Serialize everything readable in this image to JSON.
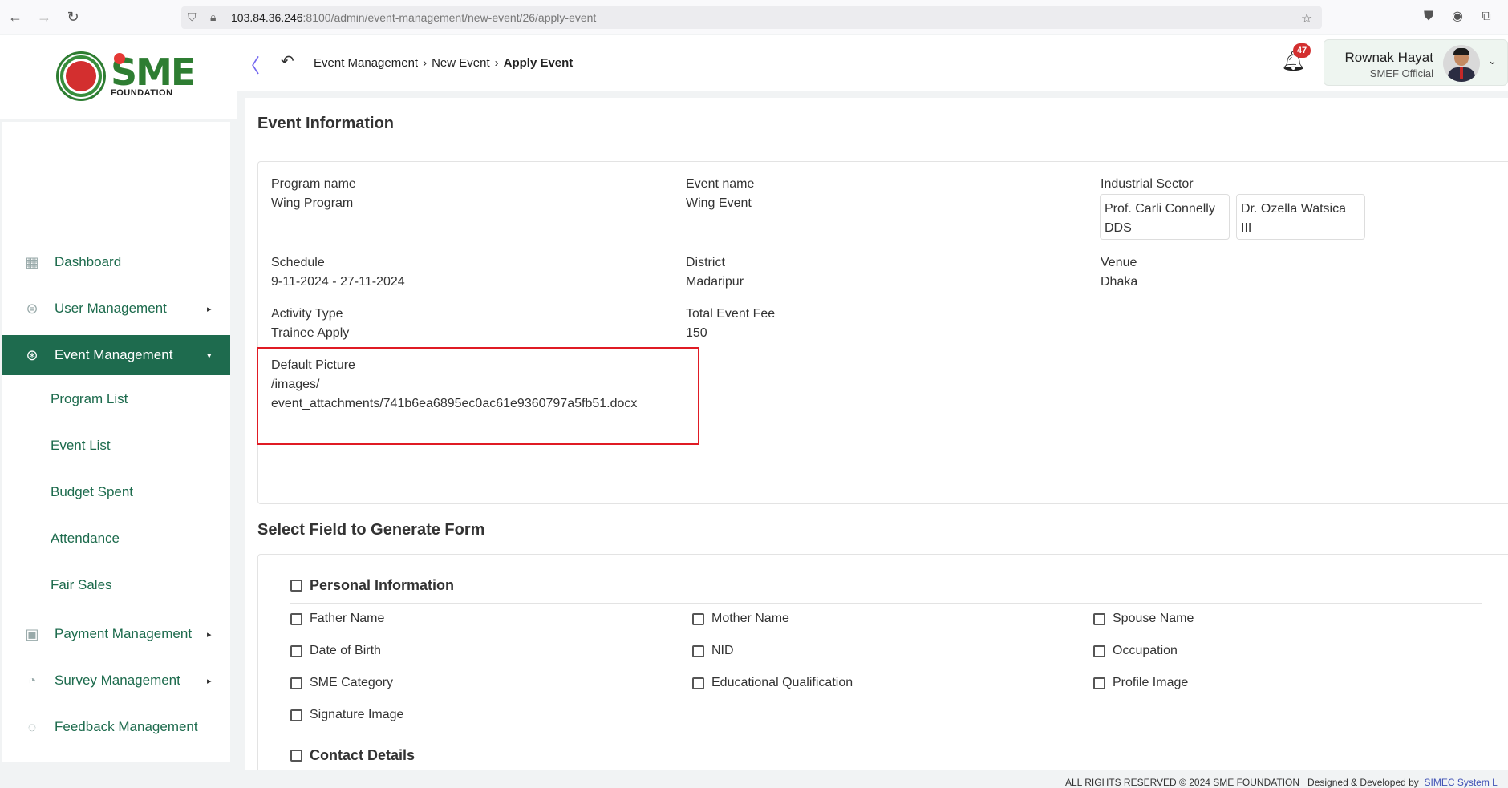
{
  "browser": {
    "url_host": "103.84.36.246",
    "url_rest": ":8100/admin/event-management/new-event/26/apply-event"
  },
  "brand": {
    "logo_text": "SME",
    "foundation": "FOUNDATION"
  },
  "sidebar": {
    "items": [
      {
        "label": "Dashboard",
        "icon": "grid-icon"
      },
      {
        "label": "User Management",
        "icon": "user-shield-icon"
      },
      {
        "label": "Event Management",
        "icon": "event-icon"
      },
      {
        "label": "Payment Management",
        "icon": "payment-icon"
      },
      {
        "label": "Survey Management",
        "icon": "pie-chart-icon"
      },
      {
        "label": "Feedback Management",
        "icon": "feedback-icon"
      }
    ],
    "sub_items": [
      "Program List",
      "Event List",
      "Budget Spent",
      "Attendance",
      "Fair Sales"
    ]
  },
  "header": {
    "breadcrumb": [
      "Event Management",
      "New Event",
      "Apply Event"
    ],
    "notification_count": "47",
    "user_name": "Rownak Hayat",
    "user_role": "SMEF Official"
  },
  "event_info": {
    "title": "Event Information",
    "program_name_label": "Program name",
    "program_name": "Wing Program",
    "event_name_label": "Event name",
    "event_name": "Wing Event",
    "industrial_sector_label": "Industrial Sector",
    "sector_tags": [
      {
        "line1": "Prof. Carli Connelly",
        "line2": "DDS"
      },
      {
        "line1": "Dr. Ozella Watsica",
        "line2": "III"
      }
    ],
    "schedule_label": "Schedule",
    "schedule": "9-11-2024 - 27-11-2024",
    "district_label": "District",
    "district": "Madaripur",
    "venue_label": "Venue",
    "venue": "Dhaka",
    "activity_type_label": "Activity Type",
    "activity_type": "Trainee Apply",
    "total_fee_label": "Total Event Fee",
    "total_fee": "150",
    "default_picture_label": "Default Picture",
    "default_picture_line1": "/images/",
    "default_picture_line2": "event_attachments/741b6ea6895ec0ac61e9360797a5fb51.docx"
  },
  "form_fields": {
    "title": "Select Field to Generate Form",
    "personal_info": "Personal Information",
    "fields": [
      "Father Name",
      "Mother Name",
      "Spouse Name",
      "Date of Birth",
      "NID",
      "Occupation",
      "SME Category",
      "Educational Qualification",
      "Profile Image",
      "Signature Image"
    ],
    "contact_details": "Contact Details"
  },
  "footer": {
    "rights": "ALL RIGHTS RESERVED © 2024 SME FOUNDATION",
    "designed": "Designed & Developed by",
    "developer": "SIMEC System L"
  }
}
